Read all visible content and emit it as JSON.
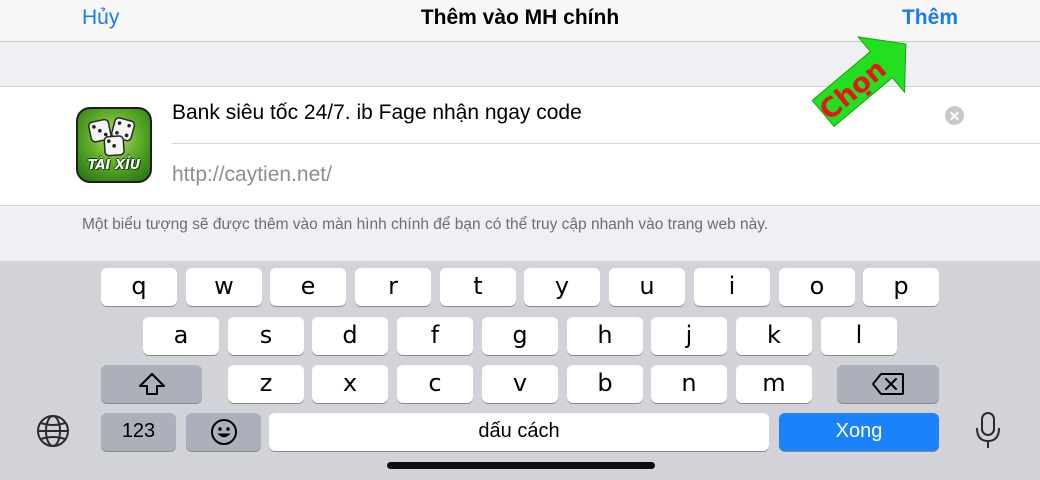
{
  "navbar": {
    "cancel_label": "Hủy",
    "title": "Thêm vào MH chính",
    "add_label": "Thêm"
  },
  "bookmark": {
    "icon_text": "TÀI XỈU",
    "title_value": "Bank siêu tốc 24/7. ib Fage nhận ngay code",
    "url_value": "http://caytien.net/"
  },
  "footnote": "Một biểu tượng sẽ được thêm vào màn hình chính để bạn có thể truy cập nhanh vào trang web này.",
  "annotation": {
    "label": "Chọn",
    "color": "#22e01f"
  },
  "keyboard": {
    "row1": [
      "q",
      "w",
      "e",
      "r",
      "t",
      "y",
      "u",
      "i",
      "o",
      "p"
    ],
    "row2": [
      "a",
      "s",
      "d",
      "f",
      "g",
      "h",
      "j",
      "k",
      "l"
    ],
    "row3": [
      "z",
      "x",
      "c",
      "v",
      "b",
      "n",
      "m"
    ],
    "numbers_label": "123",
    "space_label": "dấu cách",
    "done_label": "Xong",
    "icons": {
      "shift": "shift-icon",
      "delete": "delete-icon",
      "globe": "globe-icon",
      "emoji": "emoji-icon",
      "mic": "microphone-icon"
    }
  },
  "colors": {
    "accent": "#1a7cf2",
    "done_key": "#1a82fb"
  }
}
